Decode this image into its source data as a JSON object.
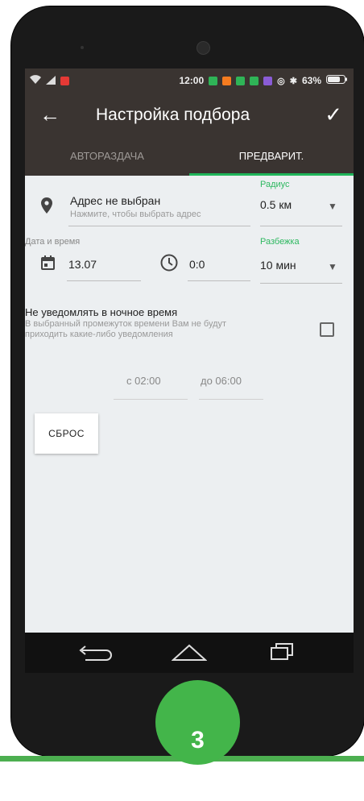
{
  "status_bar": {
    "time": "12:00",
    "battery": "63%"
  },
  "toolbar": {
    "title": "Настройка подбора"
  },
  "tabs": [
    {
      "label": "АВТОРАЗДАЧА",
      "active": false
    },
    {
      "label": "ПРЕДВАРИТ.",
      "active": true
    }
  ],
  "address": {
    "title": "Адрес не выбран",
    "hint": "Нажмите, чтобы выбрать адрес"
  },
  "radius": {
    "label": "Радиус",
    "value": "0.5 км"
  },
  "datetime": {
    "label": "Дата и время",
    "date": "13.07",
    "time": "0:0"
  },
  "spread": {
    "label": "Разбежка",
    "value": "10 мин"
  },
  "night": {
    "title": "Не уведомлять в ночное время",
    "description_line1": "В выбранный промежуток времени Вам не будут",
    "description_line2": "приходить какие-либо уведомления",
    "from": "с 02:00",
    "to": "до 06:00",
    "checked": false
  },
  "reset_button": "СБРОС",
  "badge": "3",
  "colors": {
    "accent": "#2eb860",
    "toolbar": "#3a3431",
    "badge": "#43b54a"
  }
}
